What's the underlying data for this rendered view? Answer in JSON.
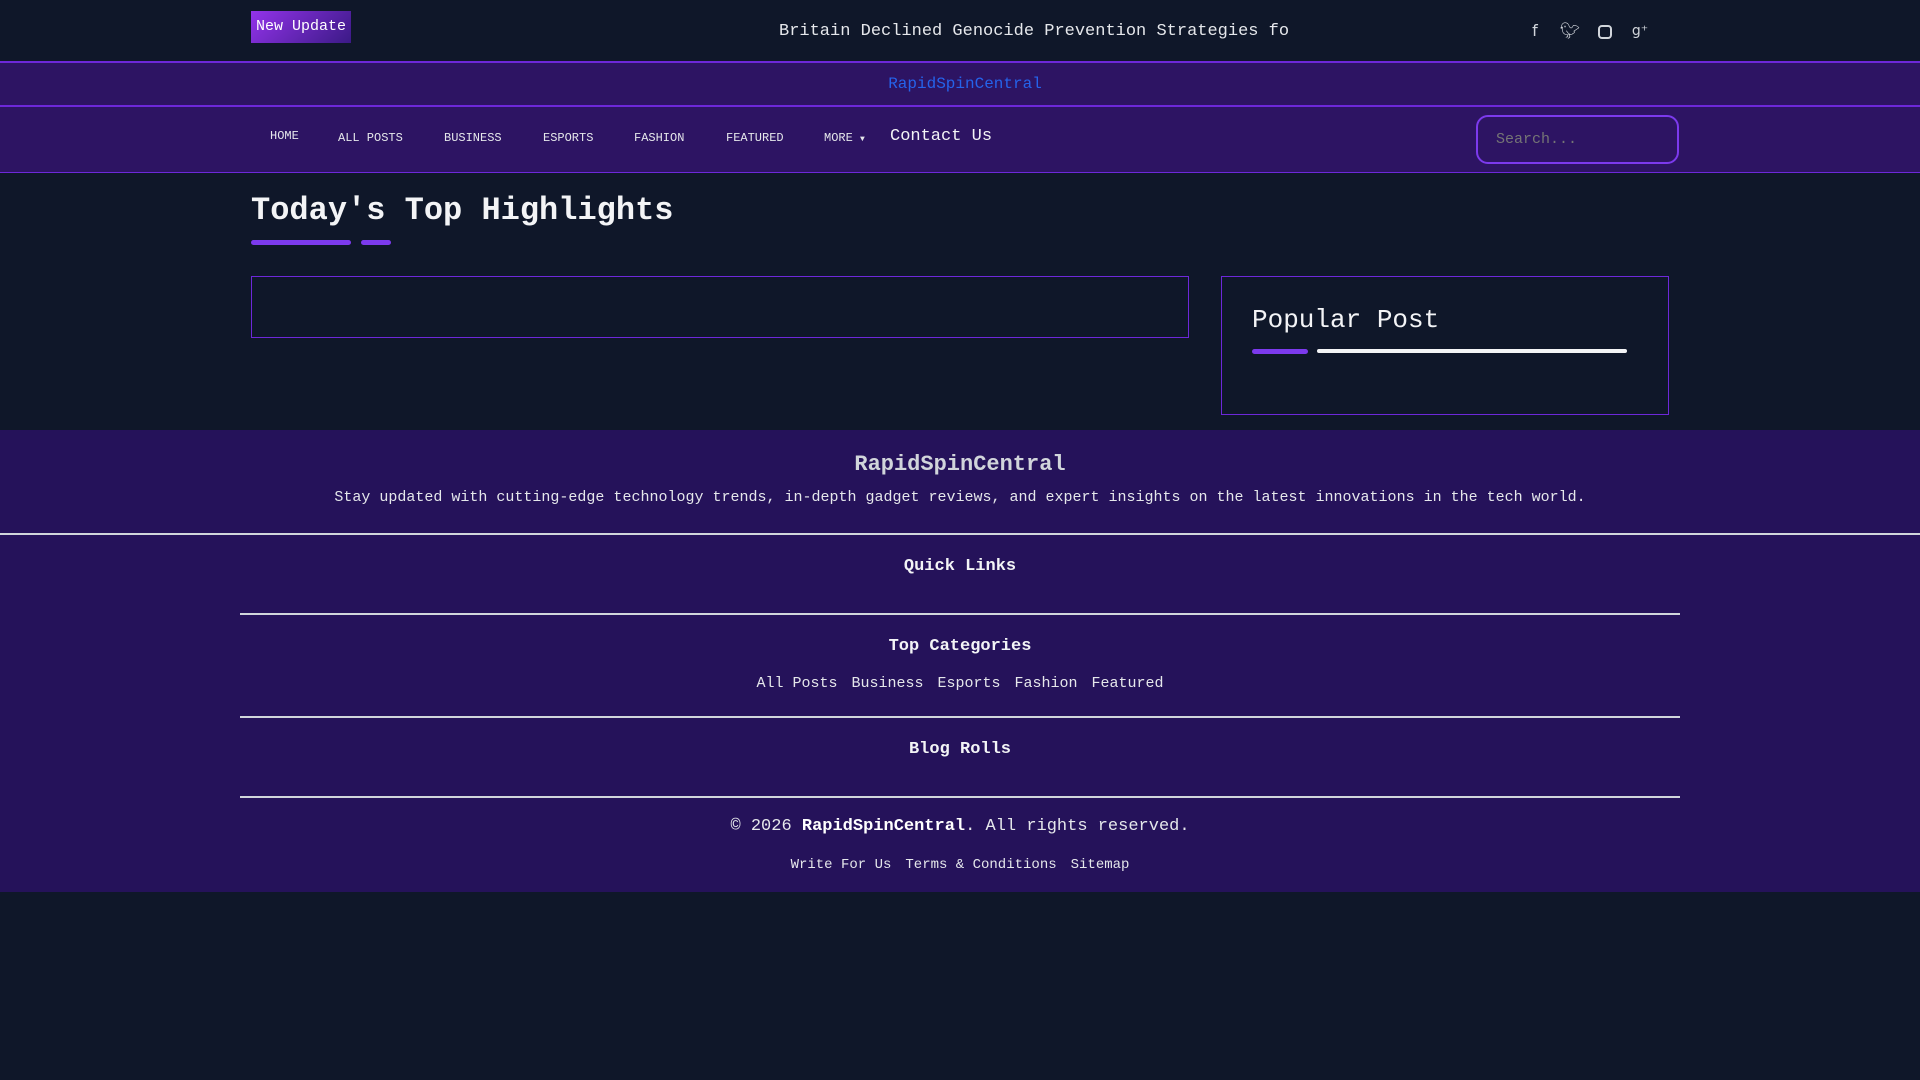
{
  "topbar": {
    "badge": "New Update",
    "ticker": "Britain Declined Genocide Prevention Strategies for the",
    "social": [
      "facebook-icon",
      "twitter-icon",
      "instagram-icon",
      "google-plus-icon"
    ]
  },
  "brand": "RapidSpinCentral",
  "nav": {
    "items": [
      "HOME",
      "ALL POSTS",
      "BUSINESS",
      "ESPORTS",
      "FASHION",
      "FEATURED",
      "MORE"
    ],
    "contact": "Contact Us",
    "search_placeholder": "Search..."
  },
  "main": {
    "title": "Today's Top Highlights",
    "popular": "Popular Post"
  },
  "footer": {
    "brand": "RapidSpinCentral",
    "description": "Stay updated with cutting-edge technology trends, in-depth gadget reviews, and expert insights on the latest innovations in the tech world.",
    "quick_links": "Quick Links",
    "top_categories": "Top Categories",
    "categories": [
      "All Posts",
      "Business",
      "Esports",
      "Fashion",
      "Featured"
    ],
    "blog_rolls": "Blog Rolls",
    "copyright_prefix": "© 2026 ",
    "copyright_brand": "RapidSpinCentral",
    "copyright_suffix": ". All rights reserved.",
    "links": [
      "Write For Us",
      "Terms & Conditions",
      "Sitemap"
    ]
  },
  "colors": {
    "accent": "#7c3aed",
    "brand_link": "#2563eb",
    "nav_bg": "#2d1463",
    "footer_bg": "#25125a",
    "page_bg": "#0f1729"
  }
}
